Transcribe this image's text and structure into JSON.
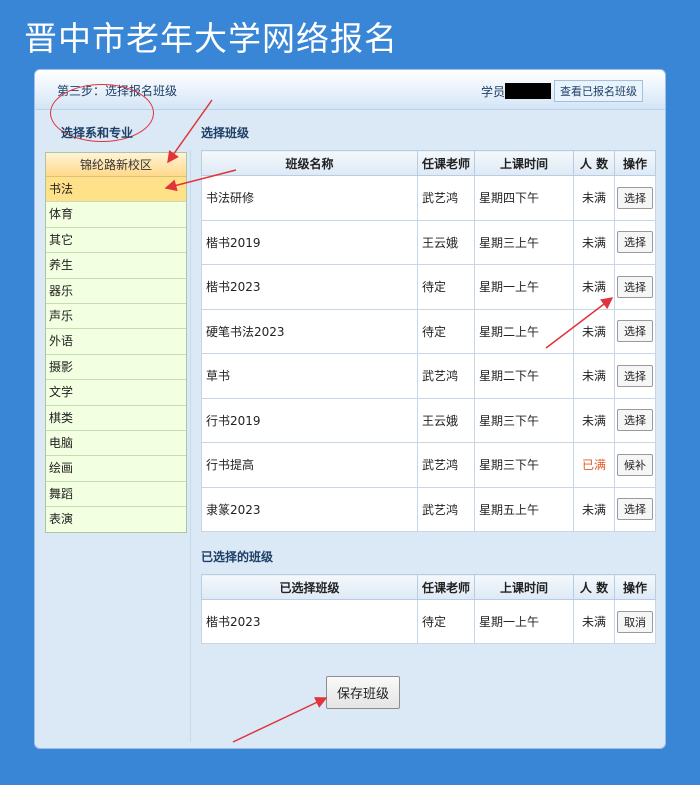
{
  "site_title": "晋中市老年大学网络报名",
  "header": {
    "step_text": "第三步：选择报名班级",
    "student_label": "学员",
    "view_enrolled_button": "查看已报名班级"
  },
  "dept_heading": "选择系和专业",
  "class_heading": "选择班级",
  "campus": {
    "name": "锦纶路新校区",
    "departments": [
      "书法",
      "体育",
      "其它",
      "养生",
      "器乐",
      "声乐",
      "外语",
      "摄影",
      "文学",
      "棋类",
      "电脑",
      "绘画",
      "舞蹈",
      "表演"
    ],
    "selected": "书法"
  },
  "class_table": {
    "headers": [
      "班级名称",
      "任课老师",
      "上课时间",
      "人 数",
      "操作"
    ],
    "rows": [
      {
        "name": "书法研修",
        "teacher": "武艺鸿",
        "time": "星期四下午",
        "status": "未满",
        "action": "选择"
      },
      {
        "name": "楷书2019",
        "teacher": "王云娥",
        "time": "星期三上午",
        "status": "未满",
        "action": "选择"
      },
      {
        "name": "楷书2023",
        "teacher": "待定",
        "time": "星期一上午",
        "status": "未满",
        "action": "选择"
      },
      {
        "name": "硬笔书法2023",
        "teacher": "待定",
        "time": "星期二上午",
        "status": "未满",
        "action": "选择"
      },
      {
        "name": "草书",
        "teacher": "武艺鸿",
        "time": "星期二下午",
        "status": "未满",
        "action": "选择"
      },
      {
        "name": "行书2019",
        "teacher": "王云娥",
        "time": "星期三下午",
        "status": "未满",
        "action": "选择"
      },
      {
        "name": "行书提高",
        "teacher": "武艺鸿",
        "time": "星期三下午",
        "status": "已满",
        "action": "候补"
      },
      {
        "name": "隶篆2023",
        "teacher": "武艺鸿",
        "time": "星期五上午",
        "status": "未满",
        "action": "选择"
      }
    ]
  },
  "selected_heading": "已选择的班级",
  "selected_table": {
    "headers": [
      "已选择班级",
      "任课老师",
      "上课时间",
      "人 数",
      "操作"
    ],
    "rows": [
      {
        "name": "楷书2023",
        "teacher": "待定",
        "time": "星期一上午",
        "status": "未满",
        "action": "取消"
      }
    ]
  },
  "save_button": "保存班级",
  "colors": {
    "background": "#3a86d6",
    "full_status": "#e05a2a",
    "selected_dept": "#ffe189",
    "annotation": "#e0343a"
  }
}
